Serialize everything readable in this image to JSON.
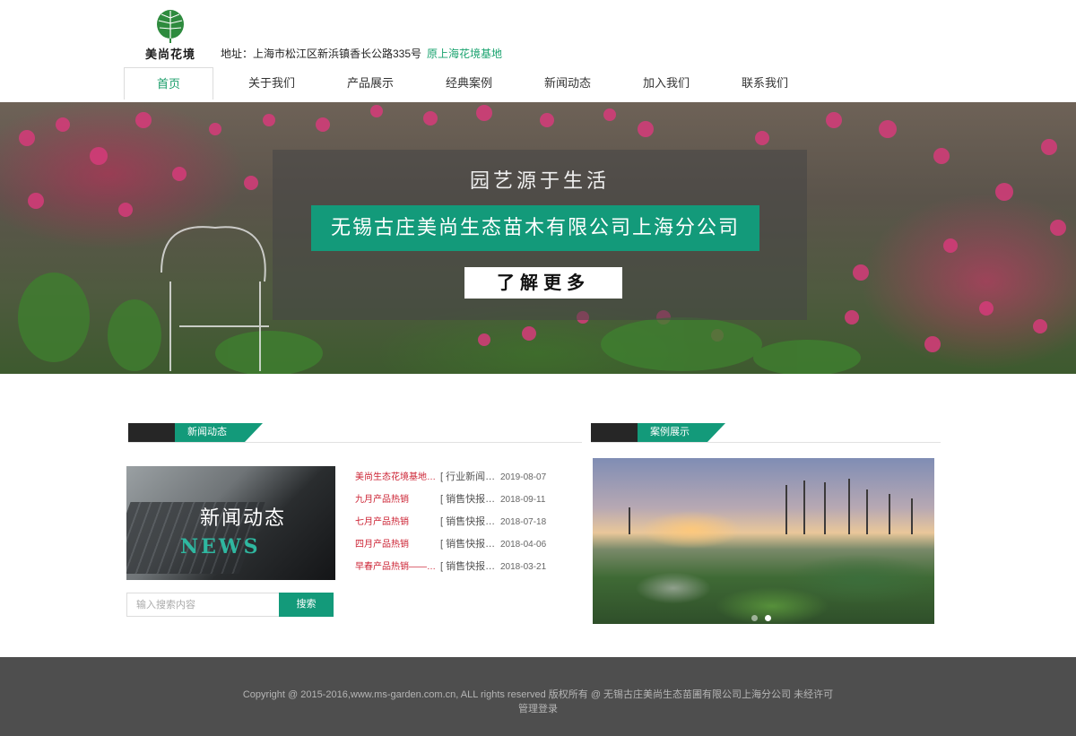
{
  "header": {
    "logo_text": "美尚花境",
    "address": "地址：上海市松江区新浜镇香长公路335号",
    "address_highlight": "原上海花境基地"
  },
  "nav": {
    "items": [
      {
        "label": "首页",
        "active": true
      },
      {
        "label": "关于我们"
      },
      {
        "label": "产品展示"
      },
      {
        "label": "经典案例"
      },
      {
        "label": "新闻动态"
      },
      {
        "label": "加入我们"
      },
      {
        "label": "联系我们"
      }
    ]
  },
  "banner": {
    "slogan": "园艺源于生活",
    "company": "无锡古庄美尚生态苗木有限公司上海分公司",
    "more_button": "了解更多"
  },
  "news_section": {
    "title": "新闻动态",
    "image_title": "新闻动态",
    "image_subtitle": "NEWS",
    "items": [
      {
        "title": "美尚生态花境基地参...",
        "category": "[ 行业新闻 ...",
        "date": "2019-08-07"
      },
      {
        "title": "九月产品热销",
        "category": "[ 销售快报 ...",
        "date": "2018-09-11"
      },
      {
        "title": "七月产品热销",
        "category": "[ 销售快报 ...",
        "date": "2018-07-18"
      },
      {
        "title": "四月产品热销",
        "category": "[ 销售快报 ...",
        "date": "2018-04-06"
      },
      {
        "title": "早春产品热销——花...",
        "category": "[ 销售快报 ...",
        "date": "2018-03-21"
      }
    ]
  },
  "search": {
    "placeholder": "输入搜索内容",
    "button": "搜索"
  },
  "case_section": {
    "title": "案例展示",
    "slide_count": 2,
    "active_slide": 2
  },
  "footer": {
    "copyright": "Copyright @ 2015-2016,www.ms-garden.com.cn, ALL rights reserved  版权所有 @ 无锡古庄美尚生态苗圃有限公司上海分公司  未经许可",
    "admin_link": "管理登录"
  },
  "colors": {
    "accent": "#139a7a",
    "highlight_text": "#1aa36f",
    "news_title": "#cc2233",
    "footer_bg": "#4e4e4e"
  }
}
